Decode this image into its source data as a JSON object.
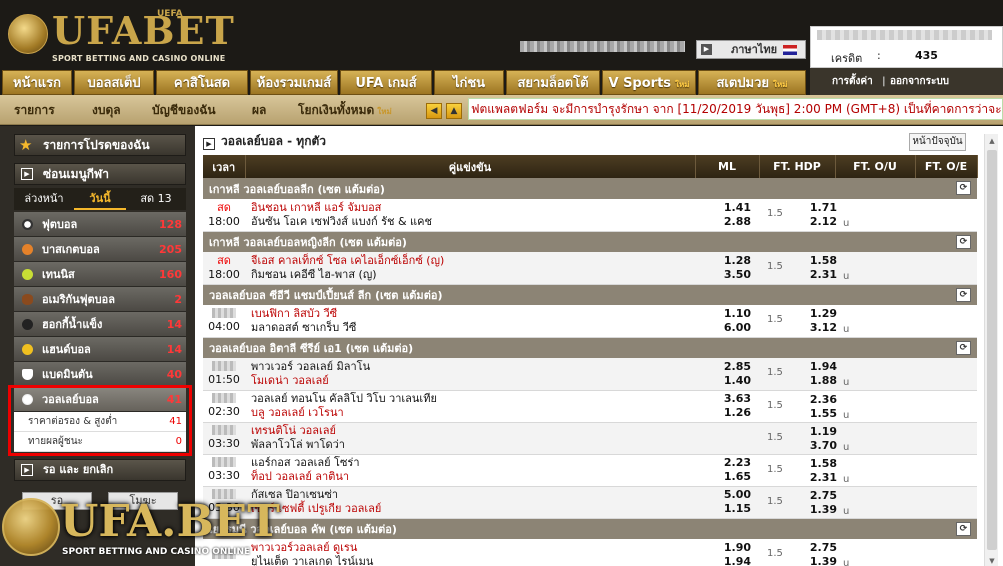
{
  "header": {
    "logo_text": "UFABET",
    "logo_uefa": "UEFA",
    "logo_tagline": "SPORT BETTING AND CASINO ONLINE",
    "language": "ภาษาไทย",
    "credit_label": "เครดิต",
    "credit_colon": ":",
    "credit_value": "435"
  },
  "main_nav": {
    "tabs": [
      {
        "label": "หน้าแรก"
      },
      {
        "label": "บอลสเต็ป"
      },
      {
        "label": "คาสิโนสด"
      },
      {
        "label": "ห้องรวมเกมส์"
      },
      {
        "label": "UFA เกมส์"
      },
      {
        "label": "ไก่ชน"
      },
      {
        "label": "สยามล็อตโต้"
      },
      {
        "label": "V Sports",
        "badge": "ใหม่"
      },
      {
        "label": "สเตปมวย",
        "badge": "ใหม่"
      }
    ],
    "settings": "การตั้งค่า",
    "logout": "ออกจากระบบ"
  },
  "sub_nav": {
    "items": [
      "รายการ",
      "งบดุล",
      "บัญชีของฉัน",
      "ผล",
      "โยกเงินทั้งหมด"
    ],
    "badge": "ใหม่",
    "ticker": "ฟตแพลตฟอร์ม จะมีการบำรุงรักษา จาก [11/20/2019 วันพุธ] 2:00 PM (GMT+8) เป็นที่คาดการว่าจะ"
  },
  "left_panel": {
    "favorites": "รายการโปรดของฉัน",
    "hide_menu": "ซ่อนเมนูกีฬา",
    "day_tabs": [
      "ล่วงหน้า",
      "วันนี้",
      "สด 13"
    ],
    "sports": [
      {
        "name": "ฟุตบอล",
        "count": "128",
        "color": "#ffffff"
      },
      {
        "name": "บาสเกตบอล",
        "count": "205",
        "color": "#e5822a"
      },
      {
        "name": "เทนนิส",
        "count": "160",
        "color": "#c8de35"
      },
      {
        "name": "อเมริกันฟุตบอล",
        "count": "2",
        "color": "#8a4a1e"
      },
      {
        "name": "ฮอกกี้น้ำแข็ง",
        "count": "14",
        "color": "#333333"
      },
      {
        "name": "แฮนด์บอล",
        "count": "14",
        "color": "#f0c020"
      },
      {
        "name": "แบดมินตัน",
        "count": "40",
        "color": "#ffffff"
      }
    ],
    "volleyball": {
      "name": "วอลเลย์บอล",
      "count": "41",
      "color": "#e8e8e8"
    },
    "volleyball_sub": [
      {
        "name": "ราคาต่อรอง & สูงต่ำ",
        "count": "41"
      },
      {
        "name": "ทายผลผู้ชนะ",
        "count": "0"
      }
    ],
    "live_header": "รอ และ ยกเลิก",
    "btn_wait": "รอ",
    "btn_void": "โมฆะ"
  },
  "content": {
    "title": "วอลเลย์บอล - ทุกตัว",
    "refresh": "หน้าปัจจุบัน",
    "columns": [
      "เวลา",
      "คู่แข่งขัน",
      "ML",
      "FT. HDP",
      "FT. O/U",
      "FT. O/E"
    ],
    "leagues": [
      {
        "name": "เกาหลี วอลเลย์บอลลีก (เซต แต้มต่อ)",
        "matches": [
          {
            "live": "สด",
            "time": "18:00",
            "home": "อินชอน เกาหลี แอร์ จัมบอส",
            "away": "อันซัน โอเค เซฟวิงส์ แบงก์ รัช & แคช",
            "ml_home": "1.41",
            "ml_away": "2.88",
            "hdp": "1.5",
            "hdp_home": "1.71",
            "hdp_away": "2.12",
            "u": "u",
            "fav": "home"
          }
        ]
      },
      {
        "name": "เกาหลี วอลเลย์บอลหญิงลีก (เซต แต้มต่อ)",
        "matches": [
          {
            "live": "สด",
            "time": "18:00",
            "home": "จีเอส คาลเท็กซ์ โซล เคไอเอ็กซ์เอ็กซ์ (ญ)",
            "away": "กิมชอน เคอีซี ไฮ-พาส (ญ)",
            "ml_home": "1.28",
            "ml_away": "3.50",
            "hdp": "1.5",
            "hdp_home": "1.58",
            "hdp_away": "2.31",
            "u": "u",
            "fav": "home"
          }
        ]
      },
      {
        "name": "วอลเลย์บอล ซีอีวี แชมป์เปี้ยนส์ ลีก (เซต แต้มต่อ)",
        "matches": [
          {
            "live": "",
            "time": "04:00",
            "home": "เบนฟิกา ลิสบัว วีซี",
            "away": "มลาดอสต์ ซาเกร็บ วีซี",
            "ml_home": "1.10",
            "ml_away": "6.00",
            "hdp": "1.5",
            "hdp_home": "1.29",
            "hdp_away": "3.12",
            "u": "u",
            "fav": "home"
          }
        ]
      },
      {
        "name": "วอลเลย์บอล อิตาลี ซีรีย์ เอ1 (เซต แต้มต่อ)",
        "matches": [
          {
            "live": "",
            "time": "01:50",
            "home": "พาวเวอร์ วอลเลย์ มิลาโน",
            "away": "โมเดน่า วอลเลย์",
            "ml_home": "2.85",
            "ml_away": "1.40",
            "hdp": "1.5",
            "hdp_home": "1.94",
            "hdp_away": "1.88",
            "u": "u",
            "fav": "away"
          },
          {
            "live": "",
            "time": "02:30",
            "home": "วอลเลย์ ทอนโน คัลลิโป วิโบ วาเลนเทีย",
            "away": "บลู วอลเลย์ เวโรนา",
            "ml_home": "3.63",
            "ml_away": "1.26",
            "hdp": "1.5",
            "hdp_home": "2.36",
            "hdp_away": "1.55",
            "u": "u",
            "fav": "away"
          },
          {
            "live": "",
            "time": "03:30",
            "home": "เทรนติโน่ วอลเลย์",
            "away": "พัลลาโวโล่ พาโดว่า",
            "ml_home": "",
            "ml_away": "",
            "hdp": "1.5",
            "hdp_home": "1.19",
            "hdp_away": "3.70",
            "u": "u",
            "fav": "home"
          },
          {
            "live": "",
            "time": "03:30",
            "home": "แอร์กอส วอลเลย์ โซร่า",
            "away": "ท็อป วอลเลย์ ลาตินา",
            "ml_home": "2.23",
            "ml_away": "1.65",
            "hdp": "1.5",
            "hdp_home": "1.58",
            "hdp_away": "2.31",
            "u": "u",
            "fav": "away"
          },
          {
            "live": "",
            "time": "03:30",
            "home": "กัสเซล ปิอาเซนซ่า",
            "away": "เซอร์ เซฟตี้ เปรูเกีย วอลเลย์",
            "ml_home": "5.00",
            "ml_away": "1.15",
            "hdp": "1.5",
            "hdp_home": "2.75",
            "hdp_away": "1.39",
            "u": "u",
            "fav": "away"
          }
        ]
      },
      {
        "name": "เยอรมนี วอลเลย์บอล คัพ (เซต แต้มต่อ)",
        "matches": [
          {
            "live": "",
            "time": "",
            "home": "พาวเวอร์วอลเลย์ ดูเรน",
            "away": "ยูไนเต็ด วาเลเกด ไรน์เมน",
            "ml_home": "1.90",
            "ml_away": "1.94",
            "hdp": "1.5",
            "hdp_home": "2.75",
            "hdp_away": "1.39",
            "u": "u",
            "fav": "home"
          }
        ]
      }
    ]
  },
  "watermark": {
    "text": "UFA.BET",
    "tagline": "SPORT BETTING AND CASINO ONLINE"
  }
}
